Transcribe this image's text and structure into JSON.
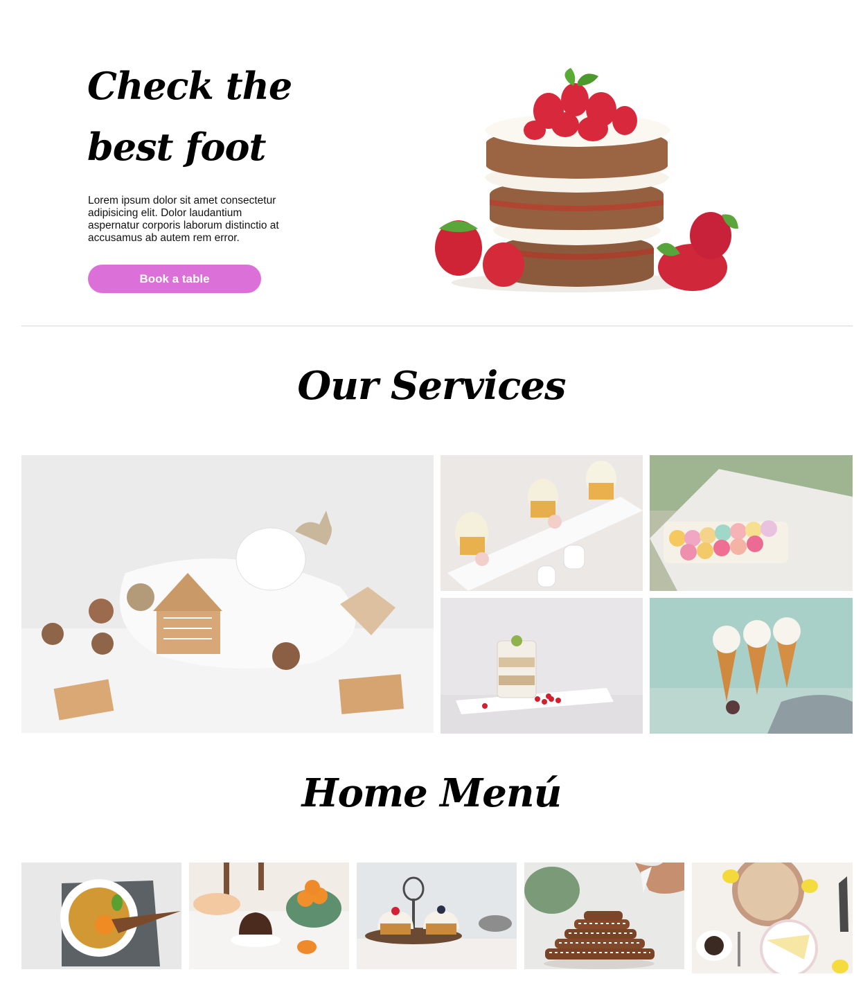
{
  "hero": {
    "title_line1": "Check the",
    "title_line2": "best foot",
    "description": "Lorem ipsum dolor sit amet consectetur adipisicing elit. Dolor laudantium aspernatur corporis laborum distinctio at accusamus ab autem rem error.",
    "cta_label": "Book a table",
    "image_icon": "strawberry-cake-image"
  },
  "services": {
    "title": "Our Services",
    "images": [
      "gingerbread-house-image",
      "cupcakes-plate-image",
      "macarons-box-image",
      "parfait-glass-image",
      "ice-cream-cones-image"
    ]
  },
  "menu": {
    "title": "Home Menú",
    "images": [
      "creme-brulee-image",
      "muffin-apricots-image",
      "cupcake-stand-image",
      "gingerbread-stack-image",
      "lemon-cake-image"
    ]
  },
  "colors": {
    "accent": "#db70d8",
    "divider": "#d6d6d6"
  }
}
